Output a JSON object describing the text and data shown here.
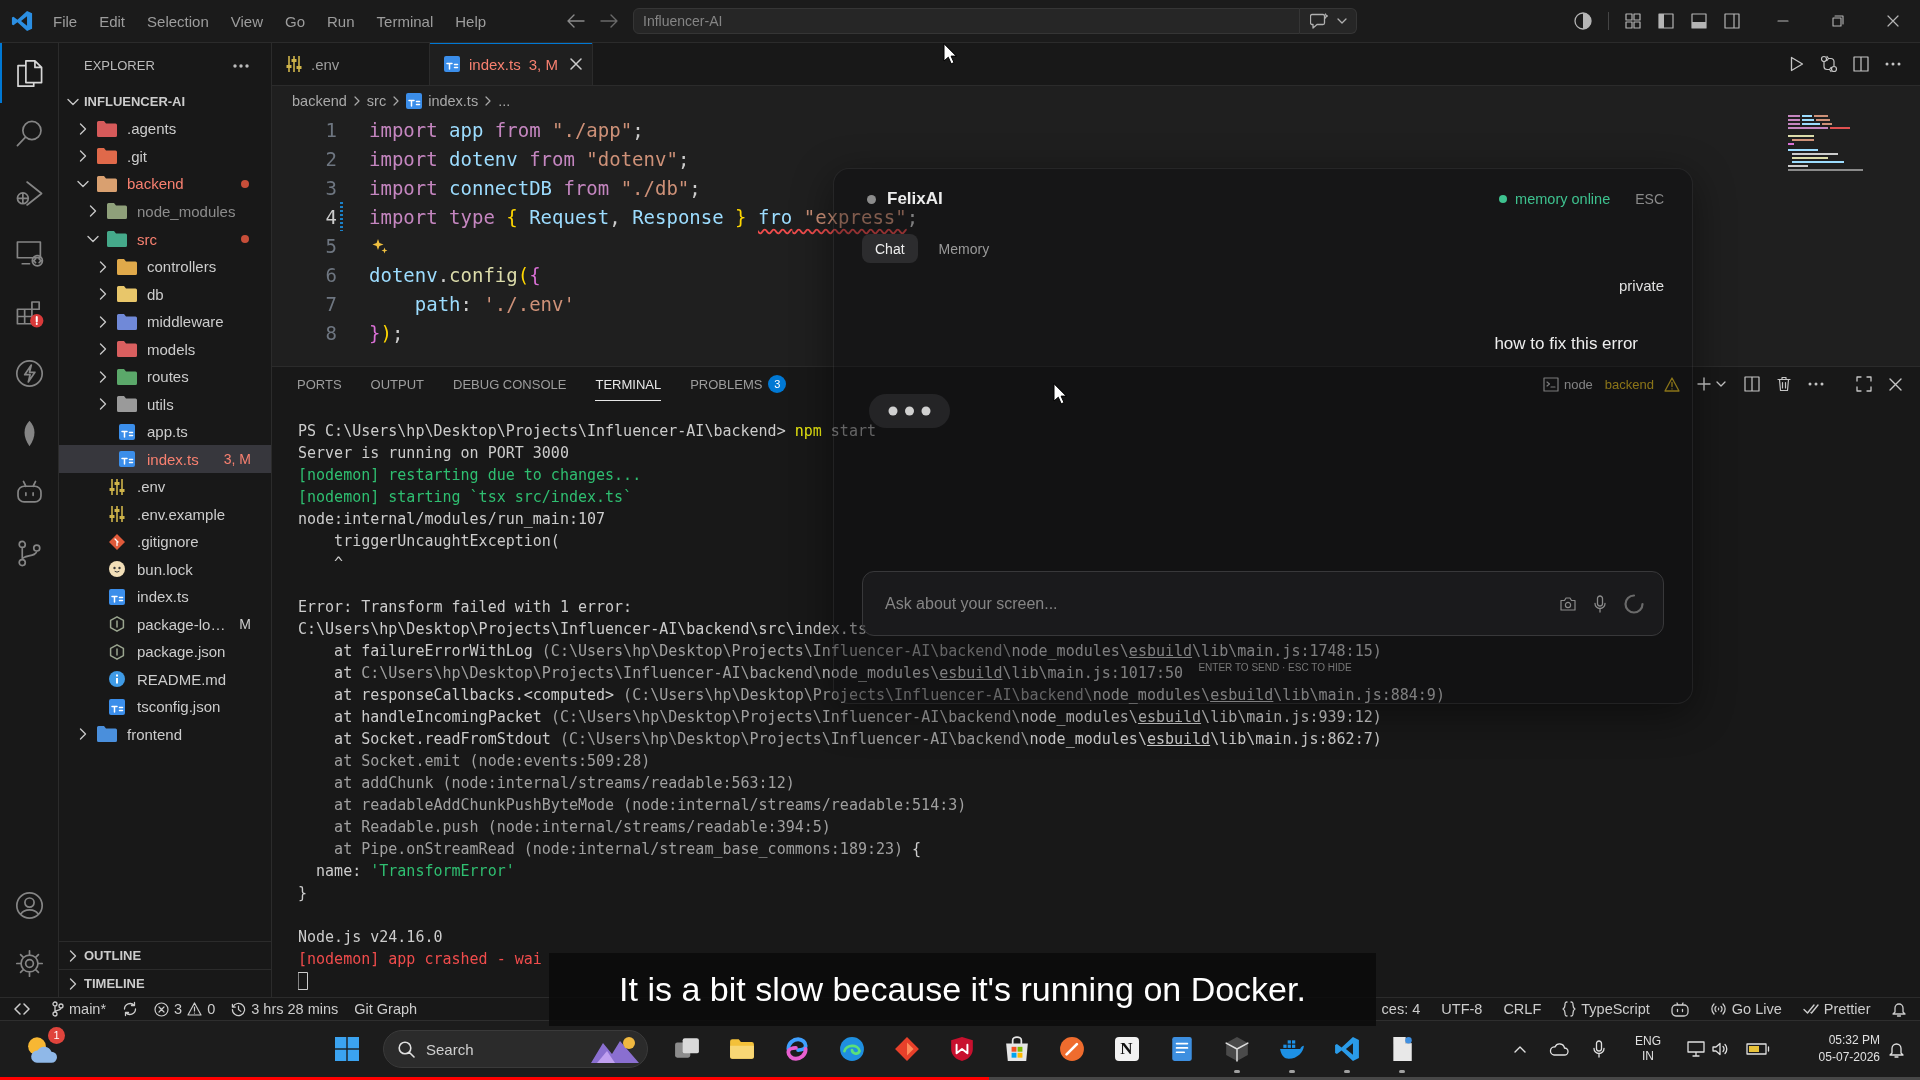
{
  "title_bar": {
    "menu": [
      "File",
      "Edit",
      "Selection",
      "View",
      "Go",
      "Run",
      "Terminal",
      "Help"
    ],
    "command_center": {
      "label": "Influencer-AI"
    }
  },
  "activity_bar": {
    "items": [
      {
        "kind": "files",
        "selected": true,
        "alert": false
      },
      {
        "kind": "search",
        "selected": false,
        "alert": false
      },
      {
        "kind": "debug",
        "selected": false,
        "alert": false
      },
      {
        "kind": "remote",
        "selected": false,
        "alert": false
      },
      {
        "kind": "extensions",
        "selected": false,
        "alert": true
      },
      {
        "kind": "bolt",
        "selected": false,
        "alert": false
      },
      {
        "kind": "leaf",
        "selected": false,
        "alert": false
      },
      {
        "kind": "robot",
        "selected": false,
        "alert": false
      },
      {
        "kind": "branch",
        "selected": false,
        "alert": false
      }
    ],
    "bottom": [
      {
        "kind": "account"
      },
      {
        "kind": "gear"
      }
    ]
  },
  "explorer": {
    "title": "EXPLORER",
    "root": {
      "label": "INFLUENCER-AI",
      "expanded": true,
      "children": [
        {
          "label": ".agents",
          "kind": "folder",
          "color": "#d65a5a",
          "expanded": false,
          "selected": false,
          "error": false,
          "ignored": false
        },
        {
          "label": ".git",
          "kind": "folder",
          "color": "#e0694a",
          "expanded": false,
          "selected": false,
          "error": false,
          "ignored": false
        },
        {
          "label": "backend",
          "kind": "folder",
          "color": "#d9a070",
          "expanded": true,
          "selected": false,
          "error": true,
          "ignored": false,
          "children": [
            {
              "label": "node_modules",
              "kind": "folder",
              "color": "#8fa07a",
              "expanded": false,
              "selected": false,
              "error": false,
              "ignored": true
            },
            {
              "label": "src",
              "kind": "folder",
              "color": "#45a98a",
              "expanded": true,
              "selected": false,
              "error": true,
              "ignored": false,
              "children": [
                {
                  "label": "controllers",
                  "kind": "folder",
                  "color": "#e0a94a",
                  "expanded": false,
                  "selected": false,
                  "error": false,
                  "ignored": false
                },
                {
                  "label": "db",
                  "kind": "folder",
                  "color": "#e8c66a",
                  "expanded": false,
                  "selected": false,
                  "error": false,
                  "ignored": false
                },
                {
                  "label": "middleware",
                  "kind": "folder",
                  "color": "#7089d8",
                  "expanded": false,
                  "selected": false,
                  "error": false,
                  "ignored": false
                },
                {
                  "label": "models",
                  "kind": "folder",
                  "color": "#d95f5f",
                  "expanded": false,
                  "selected": false,
                  "error": false,
                  "ignored": false
                },
                {
                  "label": "routes",
                  "kind": "folder",
                  "color": "#5ba86a",
                  "expanded": false,
                  "selected": false,
                  "error": false,
                  "ignored": false
                },
                {
                  "label": "utils",
                  "kind": "folder",
                  "color": "#9a9a9a",
                  "expanded": false,
                  "selected": false,
                  "error": false,
                  "ignored": false
                },
                {
                  "label": "app.ts",
                  "kind": "code",
                  "color": "#3b8eea",
                  "selected": false,
                  "error": false,
                  "ignored": false
                },
                {
                  "label": "index.ts",
                  "kind": "code",
                  "color": "#3b8eea",
                  "selected": true,
                  "error": true,
                  "ignored": false,
                  "badge": "3, M"
                }
              ]
            },
            {
              "label": ".env",
              "kind": "settings",
              "color": "#cfb44a",
              "selected": false,
              "error": false,
              "ignored": false
            },
            {
              "label": ".env.example",
              "kind": "settings",
              "color": "#cfb44a",
              "selected": false,
              "error": false,
              "ignored": false
            },
            {
              "label": ".gitignore",
              "kind": "diamond",
              "color": "#e05a3a",
              "selected": false,
              "error": false,
              "ignored": false
            },
            {
              "label": "bun.lock",
              "kind": "face",
              "color": "#f2dfb8",
              "selected": false,
              "error": false,
              "ignored": false
            },
            {
              "label": "index.ts",
              "kind": "code",
              "color": "#3b8eea",
              "selected": false,
              "error": false,
              "ignored": false
            },
            {
              "label": "package-lo…",
              "kind": "hexagon",
              "color": "#9aa58f",
              "selected": false,
              "error": false,
              "ignored": false,
              "badge": "M"
            },
            {
              "label": "package.json",
              "kind": "hexagon",
              "color": "#9aa58f",
              "selected": false,
              "error": false,
              "ignored": false
            },
            {
              "label": "README.md",
              "kind": "info",
              "color": "#3f9be6",
              "selected": false,
              "error": false,
              "ignored": false
            },
            {
              "label": "tsconfig.json",
              "kind": "code",
              "color": "#3b8eea",
              "selected": false,
              "error": false,
              "ignored": false
            }
          ]
        },
        {
          "label": "frontend",
          "kind": "folder",
          "color": "#4a8fdc",
          "expanded": false,
          "selected": false,
          "error": false,
          "ignored": false
        }
      ]
    },
    "sections": [
      {
        "label": "OUTLINE",
        "expanded": false
      },
      {
        "label": "TIMELINE",
        "expanded": false
      }
    ]
  },
  "tabs": [
    {
      "label": ".env",
      "kind": "settings",
      "color": "#cfb44a",
      "selected": false,
      "error": false
    },
    {
      "label": "index.ts",
      "badge": "3, M",
      "kind": "code",
      "color": "#3b8eea",
      "selected": true,
      "error": true
    }
  ],
  "breadcrumbs": [
    {
      "label": "backend",
      "kind": "text"
    },
    {
      "label": "src",
      "kind": "text"
    },
    {
      "label": "index.ts",
      "kind": "file",
      "color": "#3b8eea"
    },
    {
      "label": "...",
      "kind": "text"
    }
  ],
  "editor": {
    "lines": [
      {
        "number": "1",
        "current": false,
        "changed": false,
        "sparkle": false,
        "tokens": [
          {
            "text": "import",
            "kind": "keyword"
          },
          {
            "text": " app",
            "kind": "variable"
          },
          {
            "text": " from",
            "kind": "keyword"
          },
          {
            "text": " \"./app\"",
            "kind": "string"
          },
          {
            "text": ";",
            "kind": "punct"
          }
        ]
      },
      {
        "number": "2",
        "current": false,
        "changed": false,
        "sparkle": false,
        "tokens": [
          {
            "text": "import",
            "kind": "keyword"
          },
          {
            "text": " dotenv",
            "kind": "variable"
          },
          {
            "text": " from",
            "kind": "keyword"
          },
          {
            "text": " \"dotenv\"",
            "kind": "string"
          },
          {
            "text": ";",
            "kind": "punct"
          }
        ]
      },
      {
        "number": "3",
        "current": false,
        "changed": false,
        "sparkle": false,
        "tokens": [
          {
            "text": "import",
            "kind": "keyword"
          },
          {
            "text": " connectDB",
            "kind": "variable"
          },
          {
            "text": " from",
            "kind": "keyword"
          },
          {
            "text": " \"./db\"",
            "kind": "string"
          },
          {
            "text": ";",
            "kind": "punct"
          }
        ]
      },
      {
        "number": "4",
        "current": true,
        "changed": true,
        "sparkle": false,
        "tokens": [
          {
            "text": "import",
            "kind": "keyword"
          },
          {
            "text": " type",
            "kind": "keyword"
          },
          {
            "text": " {",
            "kind": "bracket1"
          },
          {
            "text": " Request",
            "kind": "variable"
          },
          {
            "text": ",",
            "kind": "punct"
          },
          {
            "text": " Response",
            "kind": "variable"
          },
          {
            "text": " } ",
            "kind": "bracket1"
          },
          {
            "text": "fro",
            "kind": "error"
          },
          {
            "text": " \"express\"",
            "kind": "error-string"
          },
          {
            "text": ";",
            "kind": "punct"
          }
        ]
      },
      {
        "number": "5",
        "current": false,
        "changed": false,
        "sparkle": true
      },
      {
        "number": "6",
        "current": false,
        "changed": false,
        "sparkle": false,
        "tokens": [
          {
            "text": "dotenv",
            "kind": "variable"
          },
          {
            "text": ".",
            "kind": "punct"
          },
          {
            "text": "config",
            "kind": "function"
          },
          {
            "text": "(",
            "kind": "bracket1"
          },
          {
            "text": "{",
            "kind": "bracket2"
          }
        ]
      },
      {
        "number": "7",
        "current": false,
        "changed": false,
        "sparkle": false,
        "tokens": [
          {
            "text": "    path",
            "kind": "variable"
          },
          {
            "text": ":",
            "kind": "punct"
          },
          {
            "text": " './.env'",
            "kind": "string"
          }
        ]
      },
      {
        "number": "8",
        "current": false,
        "changed": false,
        "sparkle": false,
        "tokens": [
          {
            "text": "}",
            "kind": "bracket2"
          },
          {
            "text": ")",
            "kind": "bracket1"
          },
          {
            "text": ";",
            "kind": "punct"
          }
        ]
      }
    ]
  },
  "panel": {
    "tabs": [
      {
        "label": "PORTS",
        "selected": false
      },
      {
        "label": "OUTPUT",
        "selected": false
      },
      {
        "label": "DEBUG CONSOLE",
        "selected": false
      },
      {
        "label": "TERMINAL",
        "selected": true
      },
      {
        "label": "PROBLEMS",
        "selected": false,
        "badge": "3"
      }
    ],
    "terminal_tab": {
      "name": "node",
      "folder": "backend",
      "warning": true
    },
    "lines": [
      {
        "kind": "text",
        "segments": [
          {
            "text": "PS C:\\Users\\hp\\Desktop\\Projects\\Influencer-AI\\backend> ",
            "kind": "plain"
          },
          {
            "text": "npm",
            "kind": "yellow"
          },
          {
            "text": " start",
            "kind": "dim"
          }
        ]
      },
      {
        "kind": "text",
        "segments": [
          {
            "text": "Server is running on PORT 3000",
            "kind": "plain"
          }
        ]
      },
      {
        "kind": "text",
        "segments": [
          {
            "text": "[nodemon] restarting due to changes...",
            "kind": "green"
          }
        ]
      },
      {
        "kind": "text",
        "segments": [
          {
            "text": "[nodemon] starting `tsx src/index.ts`",
            "kind": "green"
          }
        ]
      },
      {
        "kind": "text",
        "segments": [
          {
            "text": "node:internal/modules/run_main:107",
            "kind": "plain"
          }
        ]
      },
      {
        "kind": "text",
        "segments": [
          {
            "text": "    triggerUncaughtException(",
            "kind": "plain"
          }
        ]
      },
      {
        "kind": "text",
        "segments": [
          {
            "text": "    ^",
            "kind": "plain"
          }
        ]
      },
      {
        "kind": "blank"
      },
      {
        "kind": "text",
        "segments": [
          {
            "text": "Error: Transform failed with 1 error:",
            "kind": "plain"
          }
        ]
      },
      {
        "kind": "text",
        "segments": [
          {
            "text": "C:\\Users\\hp\\Desktop\\Projects\\Influencer-AI\\backend\\src\\index.ts",
            "kind": "plain"
          }
        ]
      },
      {
        "kind": "text",
        "segments": [
          {
            "text": "    at failureErrorWithLog ",
            "kind": "plain"
          },
          {
            "text": "(C:\\Users\\hp\\Desktop\\Projects\\Influencer-AI\\backend\\",
            "kind": "dim"
          },
          {
            "text": "node_modules\\",
            "kind": "plain"
          },
          {
            "text": "esbuild",
            "kind": "link"
          },
          {
            "text": "\\lib\\main.js:1748:15)",
            "kind": "plain"
          }
        ]
      },
      {
        "kind": "text",
        "segments": [
          {
            "text": "    at ",
            "kind": "plain"
          },
          {
            "text": "C:\\Users\\hp\\Desktop\\Projects\\Influencer-AI\\backend\\",
            "kind": "dim"
          },
          {
            "text": "node_modules\\",
            "kind": "plain"
          },
          {
            "text": "esbuild",
            "kind": "link"
          },
          {
            "text": "\\lib\\main.js:1017:50",
            "kind": "plain"
          }
        ]
      },
      {
        "kind": "text",
        "segments": [
          {
            "text": "    at responseCallbacks.<computed> ",
            "kind": "plain"
          },
          {
            "text": "(C:\\Users\\hp\\Desktop\\Projects\\Influencer-AI\\backend\\",
            "kind": "dim"
          },
          {
            "text": "node_modules\\",
            "kind": "plain"
          },
          {
            "text": "esbuild",
            "kind": "link"
          },
          {
            "text": "\\lib\\main.js:884:9)",
            "kind": "plain"
          }
        ]
      },
      {
        "kind": "text",
        "segments": [
          {
            "text": "    at handleIncomingPacket ",
            "kind": "plain"
          },
          {
            "text": "(C:\\Users\\hp\\Desktop\\Projects\\Influencer-AI\\backend\\",
            "kind": "dim"
          },
          {
            "text": "node_modules\\",
            "kind": "plain"
          },
          {
            "text": "esbuild",
            "kind": "link"
          },
          {
            "text": "\\lib\\main.js:939:12)",
            "kind": "plain"
          }
        ]
      },
      {
        "kind": "text",
        "segments": [
          {
            "text": "    at Socket.readFromStdout ",
            "kind": "plain"
          },
          {
            "text": "(C:\\Users\\hp\\Desktop\\Projects\\Influencer-AI\\backend\\",
            "kind": "dim"
          },
          {
            "text": "node_modules\\",
            "kind": "plain"
          },
          {
            "text": "esbuild",
            "kind": "link"
          },
          {
            "text": "\\lib\\main.js:862:7)",
            "kind": "plain"
          }
        ]
      },
      {
        "kind": "text",
        "segments": [
          {
            "text": "    at Socket.emit (node:events:509:28)",
            "kind": "dim"
          }
        ]
      },
      {
        "kind": "text",
        "segments": [
          {
            "text": "    at addChunk (node:internal/streams/readable:563:12)",
            "kind": "dim"
          }
        ]
      },
      {
        "kind": "text",
        "segments": [
          {
            "text": "    at readableAddChunkPushByteMode (node:internal/streams/readable:514:3)",
            "kind": "dim"
          }
        ]
      },
      {
        "kind": "text",
        "segments": [
          {
            "text": "    at Readable.push (node:internal/streams/readable:394:5)",
            "kind": "dim"
          }
        ]
      },
      {
        "kind": "text",
        "segments": [
          {
            "text": "    at Pipe.onStreamRead (node:internal/stream_base_commons:189:23)",
            "kind": "dim"
          },
          {
            "text": " {",
            "kind": "plain"
          }
        ]
      },
      {
        "kind": "text",
        "segments": [
          {
            "text": "  name: ",
            "kind": "plain"
          },
          {
            "text": "'TransformError'",
            "kind": "green"
          }
        ]
      },
      {
        "kind": "text",
        "segments": [
          {
            "text": "}",
            "kind": "plain"
          }
        ]
      },
      {
        "kind": "blank"
      },
      {
        "kind": "text",
        "segments": [
          {
            "text": "Node.js v24.16.0",
            "kind": "plain"
          }
        ]
      },
      {
        "kind": "text",
        "segments": [
          {
            "text": "[nodemon] app crashed - wai",
            "kind": "red"
          }
        ]
      },
      {
        "kind": "cursor"
      }
    ]
  },
  "assistant": {
    "title": "FelixAI",
    "status": "memory online",
    "online": true,
    "close_hint": "ESC",
    "tabs": [
      {
        "label": "Chat",
        "selected": true
      },
      {
        "label": "Memory",
        "selected": false
      }
    ],
    "messages": [
      {
        "kind": "label",
        "text": "private"
      },
      {
        "kind": "user",
        "text": "how to fix this error"
      }
    ],
    "typing": true,
    "input": {
      "placeholder": "Ask about your screen..."
    },
    "hint": "ENTER TO SEND · ESC TO HIDE"
  },
  "caption": "It is a bit slow because it's running on Docker.",
  "status_bar": {
    "left": [
      {
        "kind": "remote"
      },
      {
        "kind": "branch",
        "label": "main*"
      },
      {
        "kind": "sync"
      },
      {
        "kind": "problems",
        "errors": "3",
        "warnings": "0"
      },
      {
        "kind": "history",
        "label": "3 hrs 28 mins"
      },
      {
        "kind": "text",
        "label": "Git Graph"
      }
    ],
    "right": [
      {
        "kind": "text",
        "label": "ces: 4"
      },
      {
        "kind": "text",
        "label": "UTF-8"
      },
      {
        "kind": "text",
        "label": "CRLF"
      },
      {
        "kind": "language",
        "label": "TypeScript"
      },
      {
        "kind": "copilot"
      },
      {
        "kind": "live",
        "label": "Go Live"
      },
      {
        "kind": "prettier",
        "label": "Prettier"
      },
      {
        "kind": "bell"
      }
    ]
  },
  "taskbar": {
    "weather": {
      "badge": "1"
    },
    "search": {
      "placeholder": "Search"
    },
    "apps": [
      {
        "kind": "taskview",
        "running": false
      },
      {
        "kind": "folder",
        "running": false
      },
      {
        "kind": "swirl",
        "running": false
      },
      {
        "kind": "swoosh",
        "running": false
      },
      {
        "kind": "diamond",
        "running": false
      },
      {
        "kind": "shield",
        "running": false
      },
      {
        "kind": "bag",
        "running": false
      },
      {
        "kind": "slash",
        "running": false
      },
      {
        "kind": "letter",
        "label": "N",
        "running": false
      },
      {
        "kind": "notepad",
        "running": false
      },
      {
        "kind": "cube",
        "running": true
      },
      {
        "kind": "whale",
        "running": true
      },
      {
        "kind": "ribbon",
        "running": true
      },
      {
        "kind": "document",
        "running": true
      }
    ],
    "tray": {
      "language": "ENG",
      "region": "IN",
      "time": "05:32 PM",
      "date": "05-07-2026"
    }
  },
  "video_progress": {
    "level": 0.515
  }
}
